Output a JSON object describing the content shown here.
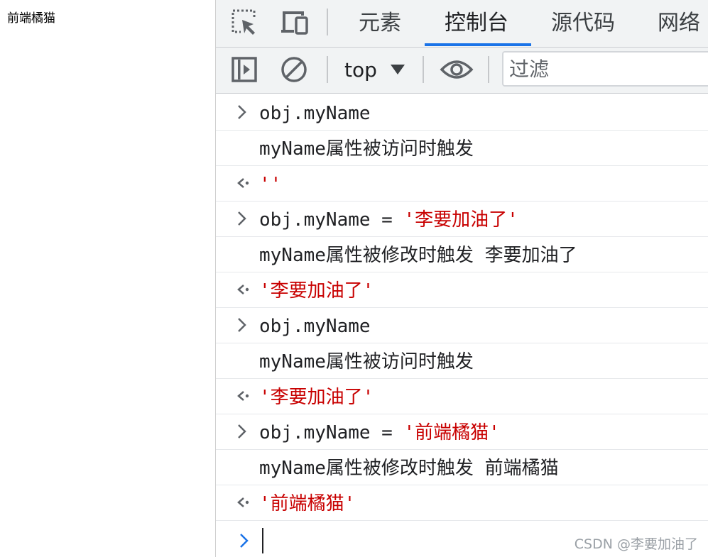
{
  "page": {
    "text": "前端橘猫"
  },
  "devtools": {
    "tabs": [
      {
        "label": "元素"
      },
      {
        "label": "控制台"
      },
      {
        "label": "源代码"
      },
      {
        "label": "网络"
      }
    ],
    "active_tab": "控制台",
    "toolbar": {
      "context": "top",
      "filter_placeholder": "过滤"
    },
    "console": {
      "rows": [
        {
          "kind": "input",
          "code": "obj.myName",
          "string": ""
        },
        {
          "kind": "log",
          "text": "myName属性被访问时触发"
        },
        {
          "kind": "result",
          "value": "''"
        },
        {
          "kind": "input",
          "code": "obj.myName = ",
          "string": "'李要加油了'"
        },
        {
          "kind": "log",
          "text": "myName属性被修改时触发 李要加油了"
        },
        {
          "kind": "result",
          "value": "'李要加油了'"
        },
        {
          "kind": "input",
          "code": "obj.myName",
          "string": ""
        },
        {
          "kind": "log",
          "text": "myName属性被访问时触发"
        },
        {
          "kind": "result",
          "value": "'李要加油了'"
        },
        {
          "kind": "input",
          "code": "obj.myName = ",
          "string": "'前端橘猫'"
        },
        {
          "kind": "log",
          "text": "myName属性被修改时触发 前端橘猫"
        },
        {
          "kind": "result",
          "value": "'前端橘猫'"
        }
      ],
      "prompt_value": ""
    }
  },
  "watermark": "CSDN @李要加油了",
  "colors": {
    "accent": "#1a73e8",
    "string": "#c80000",
    "toolbar_bg": "#f1f3f4"
  }
}
